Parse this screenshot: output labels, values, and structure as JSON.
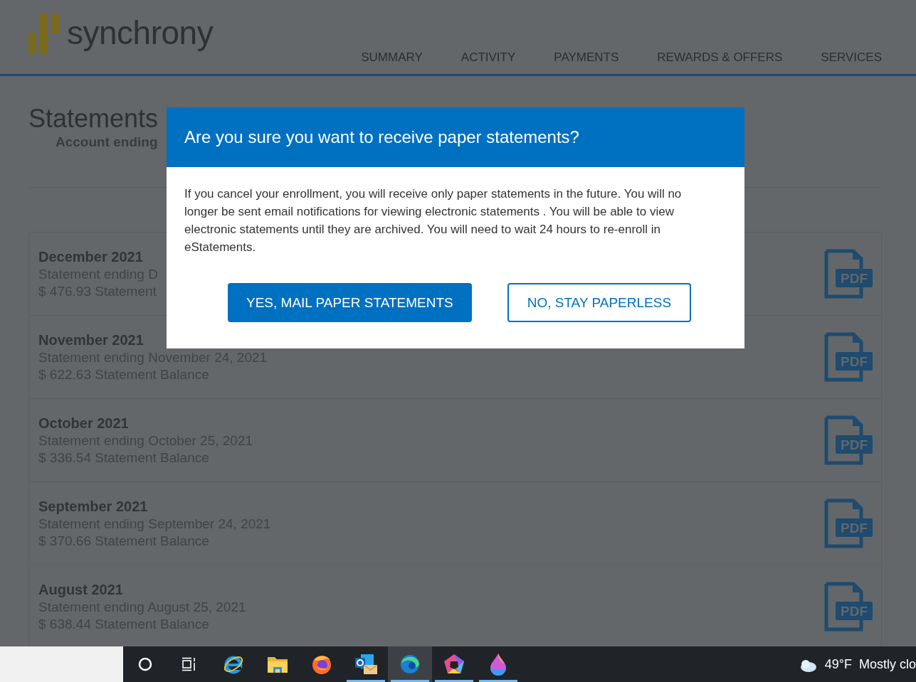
{
  "header": {
    "logo_text": "synchrony",
    "nav": [
      {
        "label": "SUMMARY"
      },
      {
        "label": "ACTIVITY"
      },
      {
        "label": "PAYMENTS"
      },
      {
        "label": "REWARDS & OFFERS"
      },
      {
        "label": "SERVICES"
      }
    ]
  },
  "page": {
    "title": "Statements",
    "subtitle": "Account ending"
  },
  "statements": [
    {
      "month": "December 2021",
      "ending": "Statement ending D",
      "balance": "$ 476.93 Statement",
      "pdf_label": "PDF"
    },
    {
      "month": "November 2021",
      "ending": "Statement ending November 24, 2021",
      "balance": "$ 622.63 Statement Balance",
      "pdf_label": "PDF"
    },
    {
      "month": "October 2021",
      "ending": "Statement ending October 25, 2021",
      "balance": "$ 336.54 Statement Balance",
      "pdf_label": "PDF"
    },
    {
      "month": "September 2021",
      "ending": "Statement ending September 24, 2021",
      "balance": "$ 370.66 Statement Balance",
      "pdf_label": "PDF"
    },
    {
      "month": "August 2021",
      "ending": "Statement ending August 25, 2021",
      "balance": "$ 638.44 Statement Balance",
      "pdf_label": "PDF"
    }
  ],
  "dialog": {
    "title": "Are you sure you want to receive paper statements?",
    "message": "If you cancel your enrollment, you will receive only paper statements in the future. You will no longer be sent email notifications for viewing electronic statements . You will be able to view electronic statements until they are archived. You will need to wait 24 hours to re-enroll in eStatements.",
    "buttons": [
      {
        "label": "YES, MAIL PAPER STATEMENTS",
        "kind": "primary"
      },
      {
        "label": "NO, STAY PAPERLESS",
        "kind": "secondary"
      }
    ]
  },
  "taskbar": {
    "apps": [
      {
        "kind": "cortana",
        "running": false,
        "selected": false
      },
      {
        "kind": "taskview",
        "running": false,
        "selected": false
      },
      {
        "kind": "ie",
        "running": false,
        "selected": false
      },
      {
        "kind": "folder",
        "running": false,
        "selected": false
      },
      {
        "kind": "firefox",
        "running": false,
        "selected": false
      },
      {
        "kind": "outlook",
        "running": true,
        "selected": false
      },
      {
        "kind": "edge",
        "running": true,
        "selected": true
      },
      {
        "kind": "pentagon",
        "running": true,
        "selected": false
      },
      {
        "kind": "drop",
        "running": true,
        "selected": false
      }
    ],
    "weather": {
      "temperature": "49°F",
      "condition": "Mostly clo"
    }
  }
}
